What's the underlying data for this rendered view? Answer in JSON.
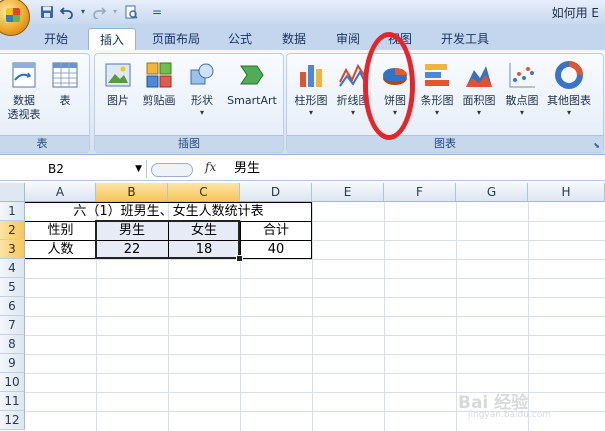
{
  "window": {
    "title": "如何用 E"
  },
  "quick_access": {
    "dropdown_glyph": "="
  },
  "tabs": [
    "开始",
    "插入",
    "页面布局",
    "公式",
    "数据",
    "审阅",
    "视图",
    "开发工具"
  ],
  "active_tab": "插入",
  "ribbon": {
    "groups": [
      {
        "label": "表",
        "buttons": [
          {
            "label": "数据",
            "label2": "透视表"
          },
          {
            "label": "表"
          }
        ]
      },
      {
        "label": "插图",
        "buttons": [
          {
            "label": "图片"
          },
          {
            "label": "剪贴画"
          },
          {
            "label": "形状"
          },
          {
            "label": "SmartArt"
          }
        ]
      },
      {
        "label": "图表",
        "buttons": [
          {
            "label": "柱形图"
          },
          {
            "label": "折线图"
          },
          {
            "label": "饼图"
          },
          {
            "label": "条形图"
          },
          {
            "label": "面积图"
          },
          {
            "label": "散点图"
          },
          {
            "label": "其他图表"
          }
        ]
      }
    ],
    "dropdown_arrow": "▾"
  },
  "formula_bar": {
    "name_box": "B2",
    "fx_label": "fx",
    "value": "男生"
  },
  "columns": [
    "A",
    "B",
    "C",
    "D",
    "E",
    "F",
    "G",
    "H"
  ],
  "selected_columns": [
    "B",
    "C"
  ],
  "rows": [
    "1",
    "2",
    "3",
    "4",
    "5",
    "6",
    "7",
    "8",
    "9",
    "10",
    "11",
    "12"
  ],
  "selected_rows": [
    "2",
    "3"
  ],
  "sheet": {
    "title": "六（1）班男生、女生人数统计表",
    "header": [
      "性别",
      "男生",
      "女生",
      "合计"
    ],
    "row": [
      "人数",
      "22",
      "18",
      "40"
    ]
  },
  "watermark": {
    "text": "Bai 经验",
    "sub": "jingyan.baidu.com"
  },
  "colors": {
    "highlight": "#e8232a",
    "selection": "#f7c65a"
  }
}
